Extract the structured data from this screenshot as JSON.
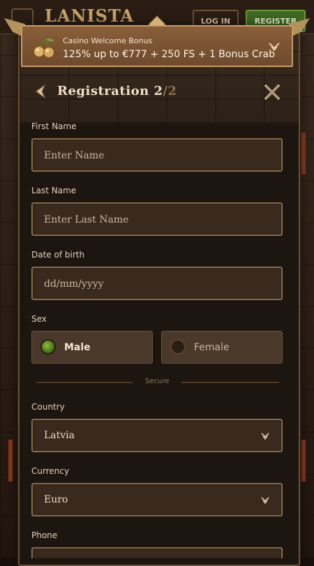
{
  "site": {
    "logo": "LANISTA",
    "login_label": "LOG IN",
    "register_label": "REGISTER"
  },
  "bonus": {
    "title": "Casino Welcome Bonus",
    "text": "125% up to €777 + 250 FS + 1 Bonus Crab",
    "icon": "cherry-icon"
  },
  "registration": {
    "title": "Registration 2",
    "step_sep": "/2"
  },
  "form": {
    "first_name": {
      "label": "First Name",
      "placeholder": "Enter Name",
      "value": ""
    },
    "last_name": {
      "label": "Last Name",
      "placeholder": "Enter Last Name",
      "value": ""
    },
    "dob": {
      "label": "Date of birth",
      "placeholder": "dd/mm/yyyy",
      "value": ""
    },
    "sex": {
      "label": "Sex",
      "options": [
        {
          "label": "Male",
          "selected": true
        },
        {
          "label": "Female",
          "selected": false
        }
      ]
    },
    "secure_text": "Secure",
    "country": {
      "label": "Country",
      "value": "Latvia"
    },
    "currency": {
      "label": "Currency",
      "value": "Euro"
    },
    "phone": {
      "label": "Phone"
    }
  },
  "colors": {
    "accent_gold": "#c89b63",
    "panel": "#1d1510",
    "field": "#3a2a1e",
    "selected_green": "#8fbf3a"
  }
}
